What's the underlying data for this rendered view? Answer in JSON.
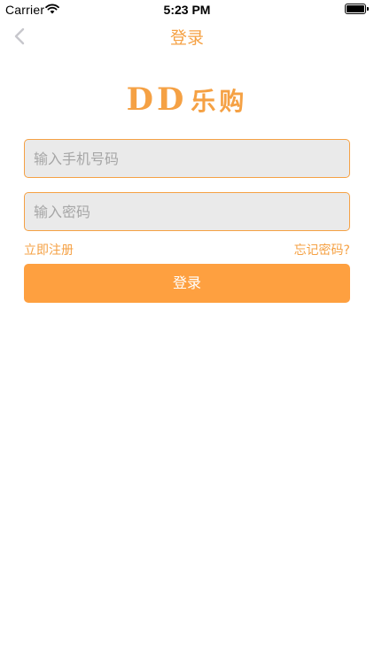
{
  "status_bar": {
    "carrier": "Carrier",
    "time": "5:23 PM",
    "battery_level": 1.0
  },
  "nav": {
    "title": "登录",
    "back_icon": "chevron-left-icon"
  },
  "logo": {
    "latin": "DD",
    "chinese": "乐购"
  },
  "form": {
    "phone_placeholder": "输入手机号码",
    "password_placeholder": "输入密码",
    "register_label": "立即注册",
    "forgot_label": "忘记密码?",
    "login_label": "登录"
  },
  "colors": {
    "accent": "#F5A144",
    "button": "#FEA040",
    "field_bg": "#EAEAEA"
  }
}
